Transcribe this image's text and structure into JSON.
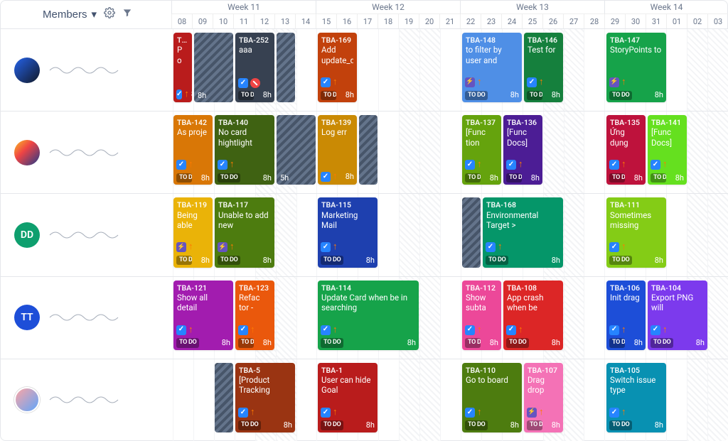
{
  "toolbar": {
    "members_label": "Members"
  },
  "weeks": [
    {
      "label": "Week 11",
      "span": 7
    },
    {
      "label": "Week 12",
      "span": 7
    },
    {
      "label": "Week 13",
      "span": 7
    },
    {
      "label": "Week 14",
      "span": 6
    }
  ],
  "days": [
    "08",
    "09",
    "10",
    "11",
    "12",
    "13",
    "14",
    "15",
    "16",
    "17",
    "18",
    "19",
    "20",
    "21",
    "22",
    "23",
    "24",
    "25",
    "26",
    "27",
    "28",
    "29",
    "30",
    "31",
    "01",
    "02",
    "03"
  ],
  "weekend_idx": [
    4,
    5,
    11,
    12,
    18,
    19,
    25,
    26
  ],
  "members": [
    {
      "initials": "",
      "cls": "img1"
    },
    {
      "initials": "",
      "cls": "img2"
    },
    {
      "initials": "DD",
      "cls": "dd"
    },
    {
      "initials": "TT",
      "cls": "tt"
    },
    {
      "initials": "",
      "cls": "img5"
    }
  ],
  "status_label": "TO DO",
  "hours_label": "8h",
  "hours_5h": "5h",
  "cards": {
    "r0": [
      {
        "id": "TBA",
        "title": "P o",
        "col": 0,
        "span": 1,
        "color": "#b91c1c",
        "icon": "chk",
        "hours": "8h",
        "todo": false
      },
      {
        "id": "TBA-252",
        "title": "aaa",
        "col": 3,
        "span": 2,
        "color": "#374151",
        "icon": "chk",
        "hours": "8h",
        "todo": true,
        "badge": "stop"
      },
      {
        "id": "TBA-169",
        "title": "Add update_da",
        "col": 7,
        "span": 2,
        "color": "#c2410c",
        "icon": "chk",
        "hours": "8h",
        "todo": true
      },
      {
        "id": "TBA-148",
        "title": "to filter by user and",
        "col": 14,
        "span": 3,
        "color": "#4f8fe6",
        "icon": "bolt",
        "hours": "8h",
        "todo": true
      },
      {
        "id": "TBA-146",
        "title": "Test for",
        "col": 17,
        "span": 2,
        "color": "#15803d",
        "icon": "chk",
        "hours": "8h",
        "todo": true
      },
      {
        "id": "TBA-147",
        "title": "StoryPoints to",
        "col": 21,
        "span": 3,
        "color": "#16a34a",
        "icon": "bolt",
        "hours": "8h",
        "todo": true
      }
    ],
    "r1": [
      {
        "id": "TBA-142",
        "title": "As proje",
        "col": 0,
        "span": 2,
        "color": "#d97706",
        "icon": "chk",
        "hours": "8h",
        "todo": true
      },
      {
        "id": "TBA-140",
        "title": "No card hightlight",
        "col": 2,
        "span": 3,
        "color": "#3f6212",
        "icon": "chk",
        "hours": "8h",
        "todo": true
      },
      {
        "id": "TBA-139",
        "title": "Log err",
        "col": 7,
        "span": 2,
        "color": "#ca8a04",
        "icon": "chk",
        "hours": "8h",
        "todo": false
      },
      {
        "id": "TBA-137",
        "title": "[Func tion",
        "col": 14,
        "span": 2,
        "color": "#65a30d",
        "icon": "chk",
        "hours": "8h",
        "todo": true
      },
      {
        "id": "TBA-136",
        "title": "[Func Docs]",
        "col": 16,
        "span": 2,
        "color": "#4c1d95",
        "icon": "chk",
        "hours": "8h",
        "todo": true
      },
      {
        "id": "TBA-135",
        "title": "Ứng dụng",
        "col": 21,
        "span": 2,
        "color": "#be123c",
        "icon": "chk",
        "hours": "8h",
        "todo": true
      },
      {
        "id": "TBA-141",
        "title": "[Func Docs]",
        "col": 23,
        "span": 2,
        "color": "#65e01f",
        "icon": "chk",
        "hours": "8h",
        "todo": true
      }
    ],
    "r2": [
      {
        "id": "TBA-119",
        "title": "Being able",
        "col": 0,
        "span": 2,
        "color": "#eab308",
        "icon": "bolt",
        "hours": "8h",
        "todo": true
      },
      {
        "id": "TBA-117",
        "title": "Unable to add new",
        "col": 2,
        "span": 3,
        "color": "#4d7c0f",
        "icon": "bolt",
        "hours": "8h",
        "todo": true
      },
      {
        "id": "TBA-115",
        "title": "Marketing Mail",
        "col": 7,
        "span": 3,
        "color": "#1e40af",
        "icon": "chk",
        "hours": "8h",
        "todo": true
      },
      {
        "id": "TBA-168",
        "title": "Environmental Target >",
        "col": 15,
        "span": 4,
        "color": "#059669",
        "icon": "chk",
        "hours": "8h",
        "todo": true,
        "light": true
      },
      {
        "id": "TBA-111",
        "title": "Sometimes missing",
        "col": 21,
        "span": 3,
        "color": "#84cc16",
        "icon": "chk",
        "hours": "8h",
        "todo": true,
        "light": true
      }
    ],
    "r3": [
      {
        "id": "TBA-121",
        "title": "Show all detail",
        "col": 0,
        "span": 3,
        "color": "#a21caf",
        "icon": "chk",
        "hours": "8h",
        "todo": true
      },
      {
        "id": "TBA-123",
        "title": "Refac tor -",
        "col": 3,
        "span": 2,
        "color": "#ea580c",
        "icon": "chk",
        "hours": "8h",
        "todo": true
      },
      {
        "id": "TBA-114",
        "title": "Update Card when be in searching",
        "col": 7,
        "span": 5,
        "color": "#16a34a",
        "icon": "chk",
        "hours": "8h",
        "todo": true
      },
      {
        "id": "TBA-112",
        "title": "Show subta",
        "col": 14,
        "span": 2,
        "color": "#ec4899",
        "icon": "chk",
        "hours": "8h",
        "todo": true
      },
      {
        "id": "TBA-108",
        "title": "App crash when be",
        "col": 16,
        "span": 3,
        "color": "#dc2626",
        "icon": "chk",
        "hours": "8h",
        "todo": true
      },
      {
        "id": "TBA-106",
        "title": "Init drag",
        "col": 21,
        "span": 2,
        "color": "#1d4ed8",
        "icon": "chk",
        "hours": "8h",
        "todo": true
      },
      {
        "id": "TBA-104",
        "title": "Export PNG will",
        "col": 23,
        "span": 3,
        "color": "#7c3aed",
        "icon": "chk",
        "hours": "8h",
        "todo": true
      }
    ],
    "r4": [
      {
        "id": "TBA-5",
        "title": "[Product Tracking",
        "col": 3,
        "span": 3,
        "color": "#9a3412",
        "icon": "chk",
        "hours": "8h",
        "todo": true
      },
      {
        "id": "TBA-1",
        "title": "User can hide Goal",
        "col": 7,
        "span": 3,
        "color": "#b91c1c",
        "icon": "chk",
        "hours": "8h",
        "todo": true
      },
      {
        "id": "TBA-110",
        "title": "Go to board",
        "col": 14,
        "span": 3,
        "color": "#4d7c0f",
        "icon": "chk",
        "hours": "8h",
        "todo": true
      },
      {
        "id": "TBA-107",
        "title": "Drag drop",
        "col": 17,
        "span": 2,
        "color": "#f472b6",
        "icon": "bolt",
        "hours": "8h",
        "todo": true
      },
      {
        "id": "TBA-105",
        "title": "Switch issue type",
        "col": 21,
        "span": 3,
        "color": "#0891b2",
        "icon": "chk",
        "hours": "8h",
        "todo": true
      }
    ]
  },
  "hatched": [
    {
      "row": 0,
      "col": 1,
      "span": 2,
      "label": "8h",
      "bottom_only": true
    },
    {
      "row": 0,
      "col": 5,
      "span": 1,
      "label": ""
    },
    {
      "row": 1,
      "col": 5,
      "span": 2,
      "label": "5h",
      "bottom_only": true
    },
    {
      "row": 1,
      "col": 9,
      "span": 1,
      "label": ""
    },
    {
      "row": 2,
      "col": 14,
      "span": 1,
      "label": ""
    },
    {
      "row": 4,
      "col": 2,
      "span": 1,
      "label": ""
    }
  ]
}
